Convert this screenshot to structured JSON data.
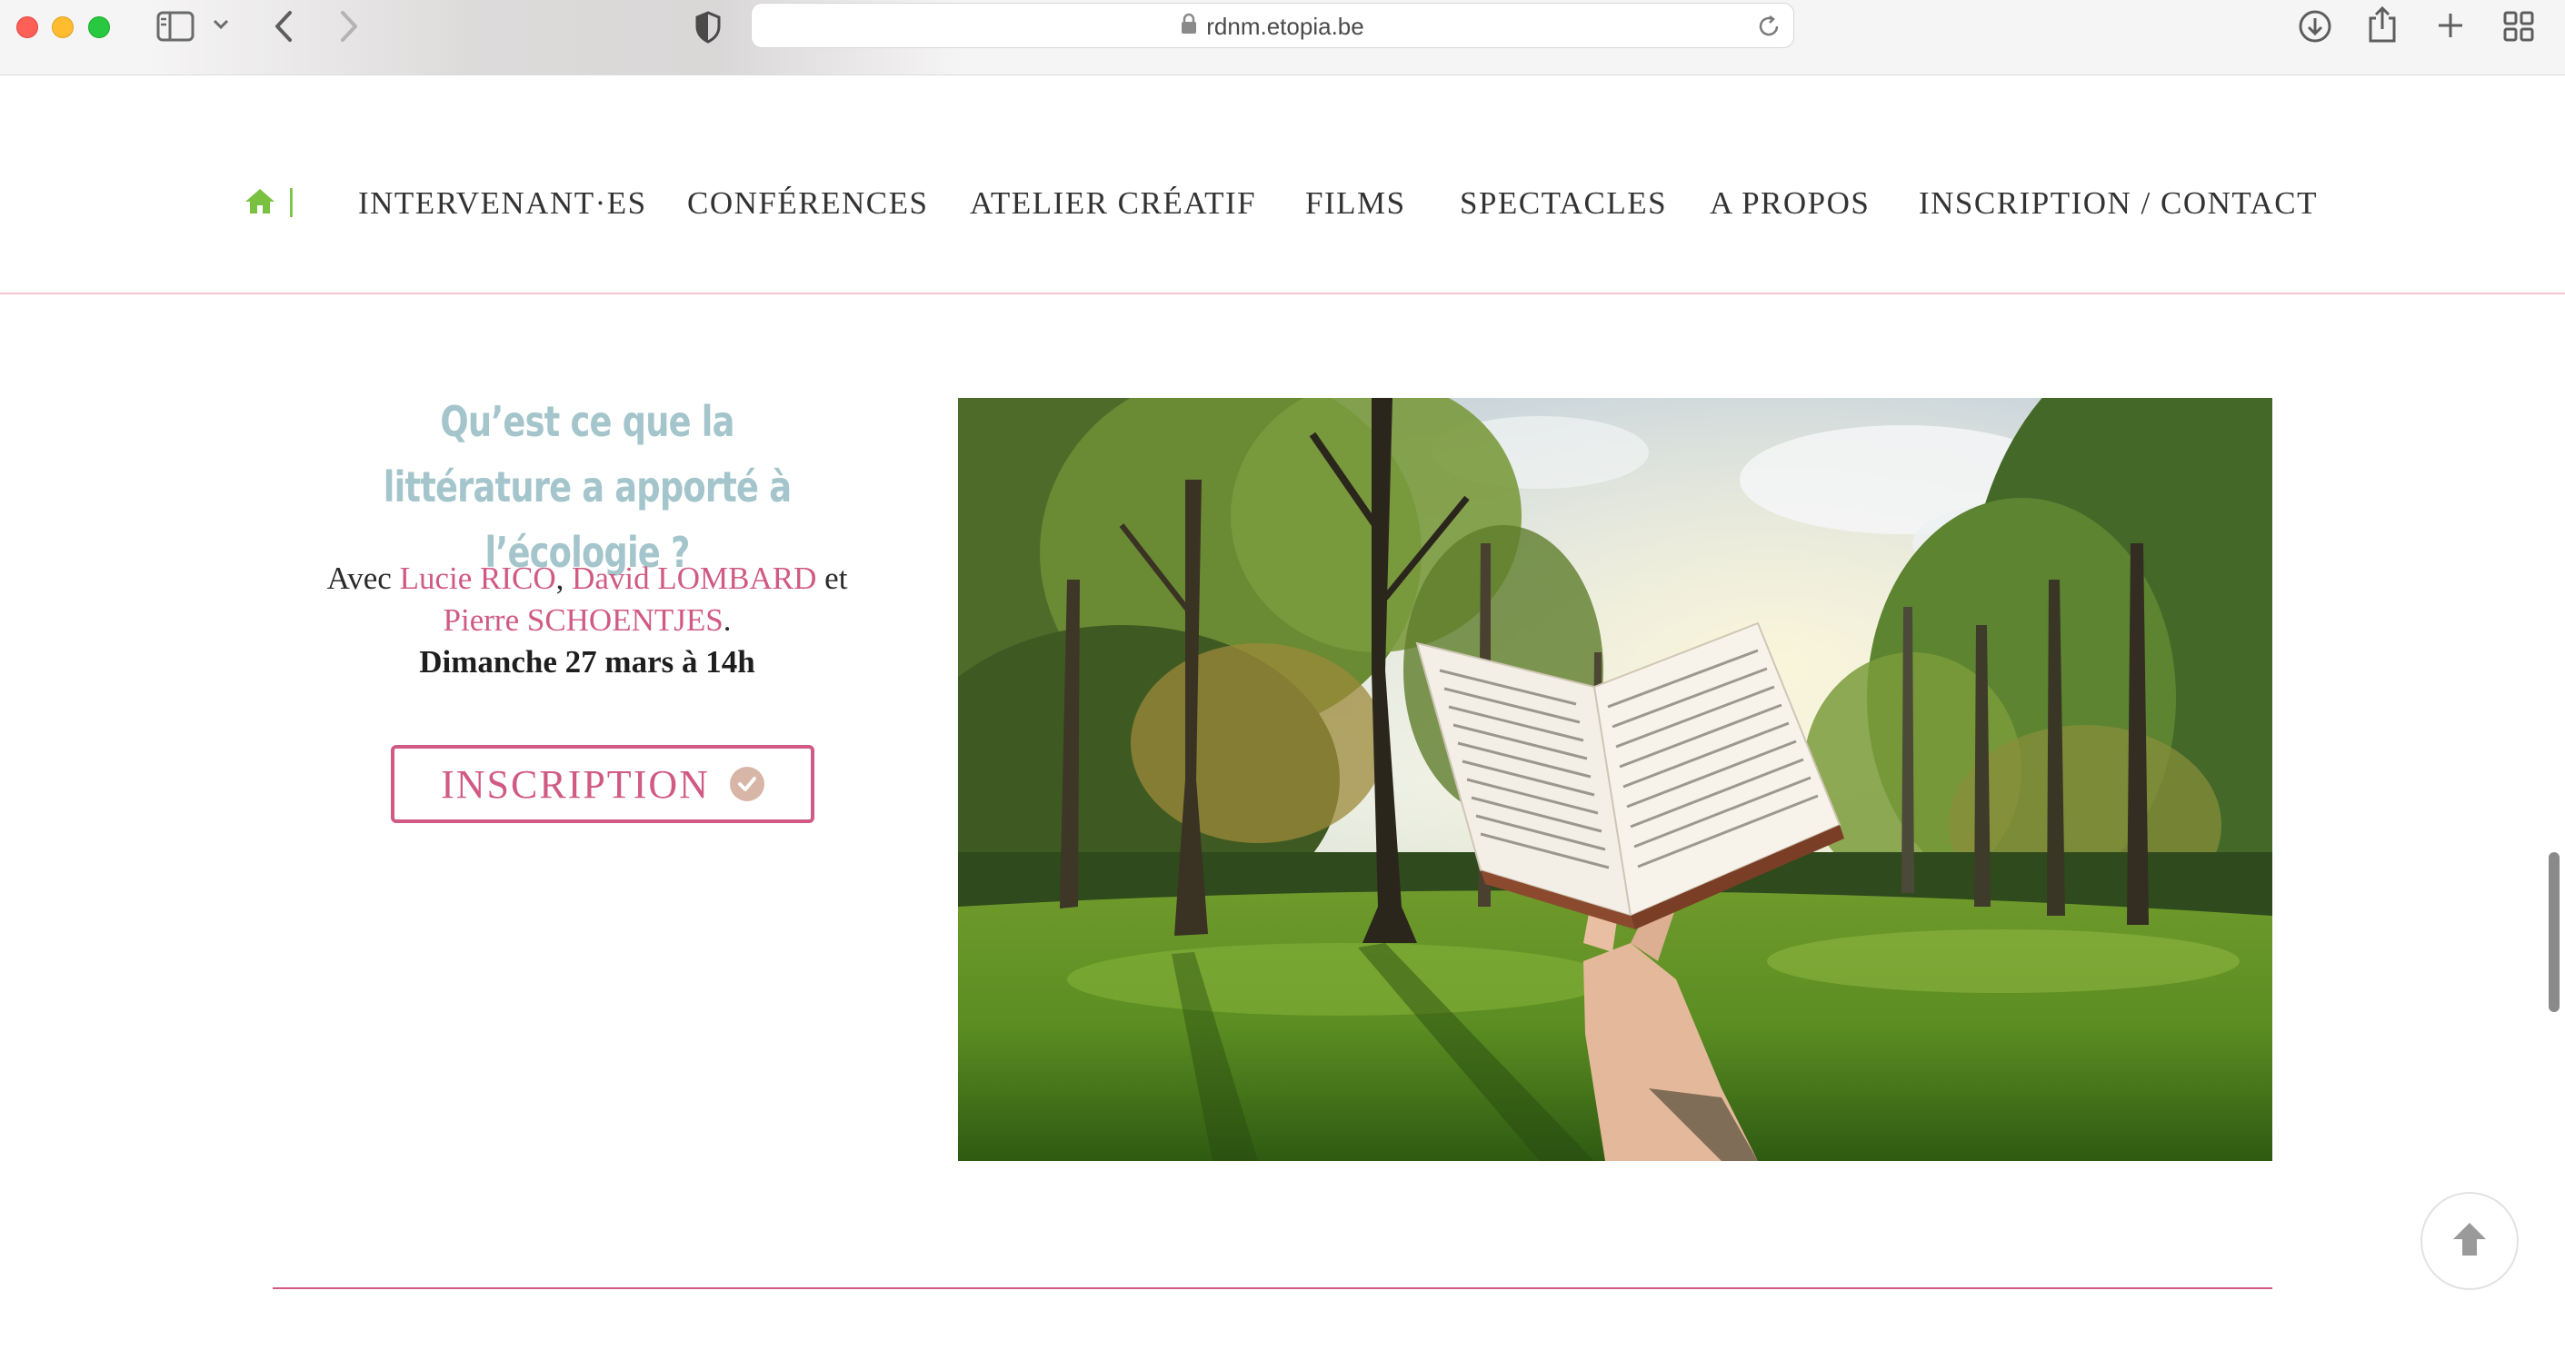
{
  "browser": {
    "url": "rdnm.etopia.be"
  },
  "nav": {
    "separator": "|",
    "items": [
      {
        "label": "INTERVENANT·ES"
      },
      {
        "label": "CONFÉRENCES"
      },
      {
        "label": "ATELIER CRÉATIF"
      },
      {
        "label": "FILMS"
      },
      {
        "label": "SPECTACLES"
      },
      {
        "label": "A PROPOS"
      },
      {
        "label": "INSCRIPTION / CONTACT"
      }
    ]
  },
  "event": {
    "title": "Qu’est ce que la littérature a apporté à l’écologie ?",
    "desc_prefix": "Avec ",
    "speaker1": "Lucie RICO",
    "sep1": ", ",
    "speaker2": "David LOMBARD",
    "sep2": " et ",
    "speaker3": "Pierre SCHOENTJES",
    "desc_end": ".",
    "date": "Dimanche 27 mars à 14h",
    "button_label": "INSCRIPTION"
  },
  "colors": {
    "accent_pink": "#d05a84",
    "title_blue": "#a4c5cb",
    "home_green": "#7ac142"
  },
  "icons": {
    "home": "home-icon",
    "check": "check-circle-icon",
    "scroll_top": "arrow-up-icon"
  }
}
